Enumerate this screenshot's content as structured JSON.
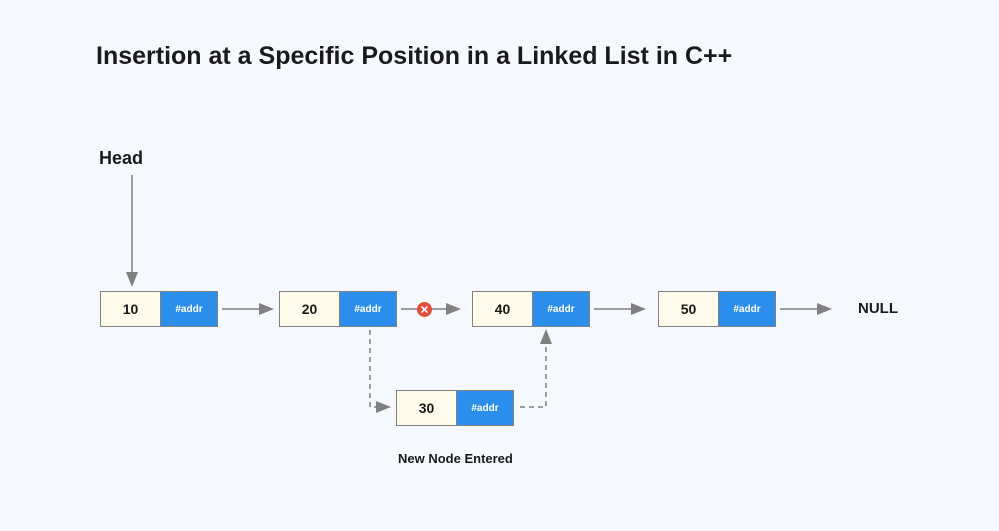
{
  "title": "Insertion at a Specific Position in a Linked List in C++",
  "head_label": "Head",
  "null_label": "NULL",
  "new_node_label": "New Node Entered",
  "addr_text": "#addr",
  "nodes": {
    "n1": {
      "value": "10"
    },
    "n2": {
      "value": "20"
    },
    "n3": {
      "value": "40"
    },
    "n4": {
      "value": "50"
    },
    "new": {
      "value": "30"
    }
  },
  "colors": {
    "bg": "#f5f8fc",
    "node_data_bg": "#fffbea",
    "node_addr_bg": "#2b8eea",
    "arrow": "#808080",
    "cross_bg": "#e74c3c"
  }
}
